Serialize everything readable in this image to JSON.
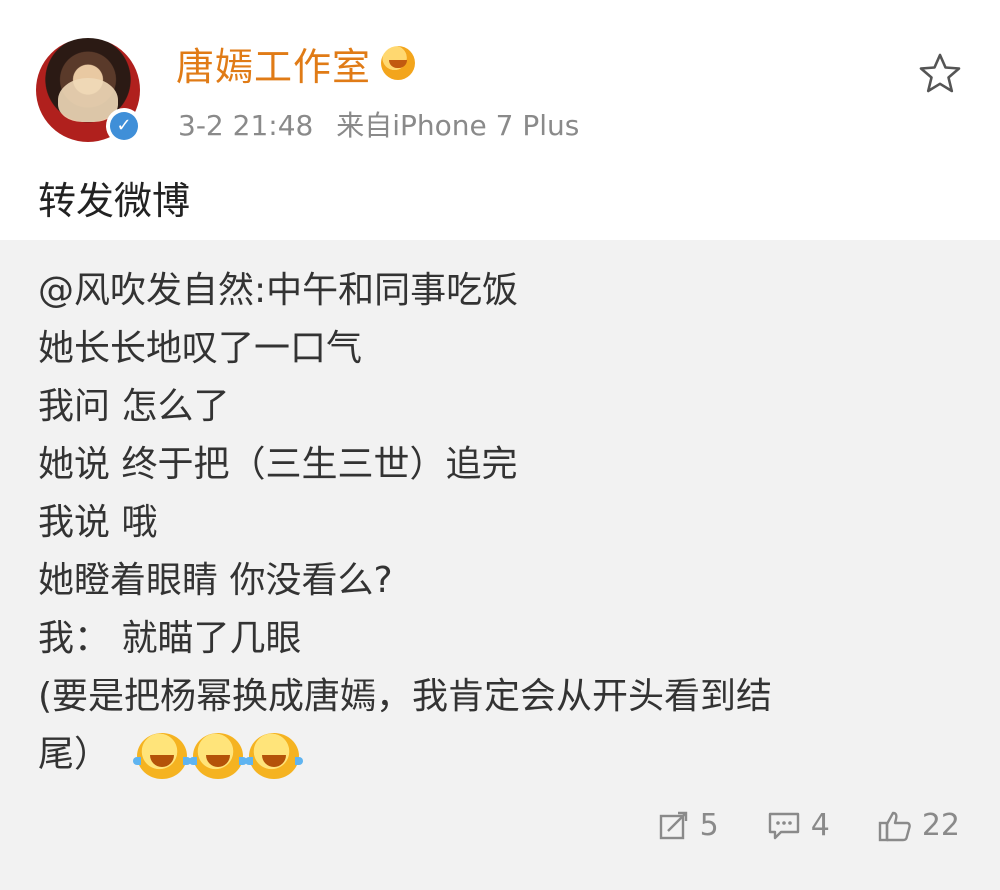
{
  "post": {
    "username": "唐嫣工作室",
    "date": "3-2 21:48",
    "source": "来自iPhone 7 Plus",
    "text": "转发微博"
  },
  "repost": {
    "lines": [
      "@风吹发自然:中午和同事吃饭",
      "她长长地叹了一口气",
      "我问 怎么了",
      "她说 终于把（三生三世）追完",
      "我说 哦",
      "她瞪着眼睛 你没看么?",
      "我：  就瞄了几眼",
      "(要是把杨幂换成唐嫣，我肯定会从开头看到结"
    ],
    "last_line": "尾）"
  },
  "actions": {
    "repost_count": "5",
    "comment_count": "4",
    "like_count": "22"
  },
  "icons": {
    "favorite": "star-icon",
    "verified": "verified-badge-icon",
    "vip": "vip-face-icon",
    "emoji": "laugh-cry-emoji",
    "repost": "repost-icon",
    "comment": "comment-icon",
    "like": "thumbs-up-icon"
  },
  "colors": {
    "username": "#e07b16",
    "meta": "#8a8a8a",
    "repost_bg": "#f2f2f2",
    "verified": "#3f8fd8"
  }
}
